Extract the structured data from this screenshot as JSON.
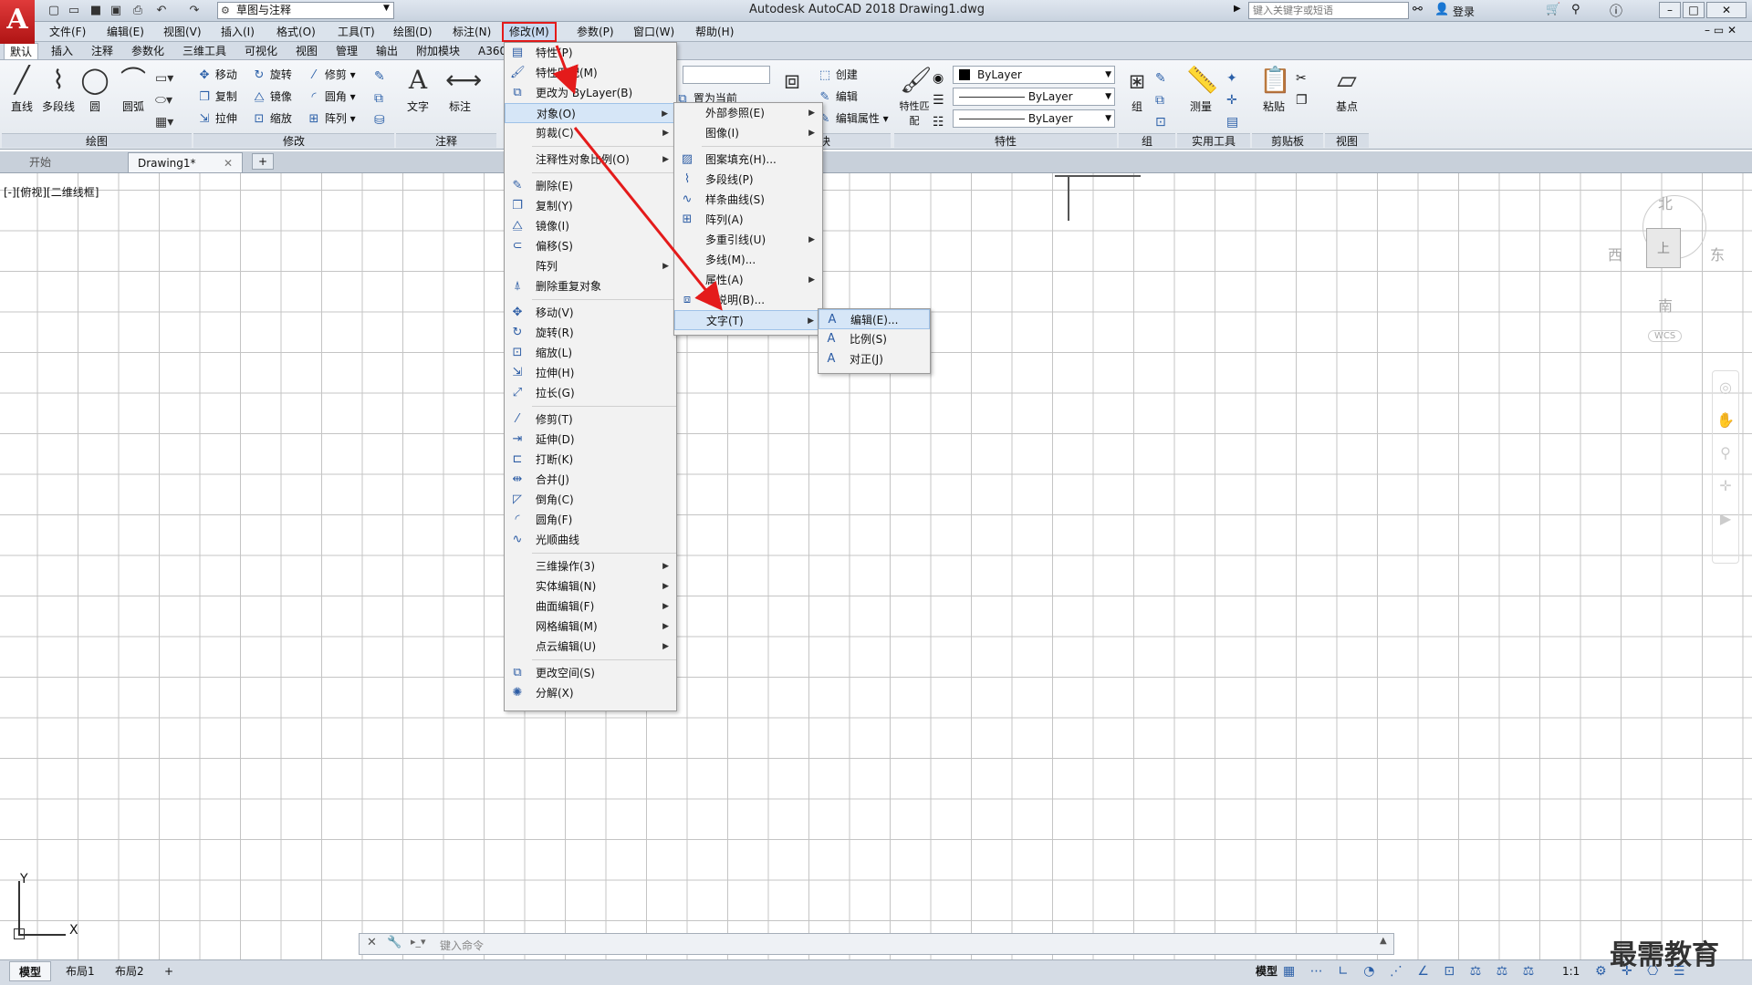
{
  "app": {
    "logo": "A",
    "title": "Autodesk AutoCAD 2018    Drawing1.dwg",
    "workspace": "草图与注释",
    "search_placeholder": "键入关键字或短语",
    "login": "登录"
  },
  "menubar": [
    "文件(F)",
    "编辑(E)",
    "视图(V)",
    "插入(I)",
    "格式(O)",
    "工具(T)",
    "绘图(D)",
    "标注(N)",
    "修改(M)",
    "参数(P)",
    "窗口(W)",
    "帮助(H)"
  ],
  "ribbon_tabs": [
    "默认",
    "插入",
    "注释",
    "参数化",
    "三维工具",
    "可视化",
    "视图",
    "管理",
    "输出",
    "附加模块",
    "A360"
  ],
  "ribbon": {
    "draw": {
      "line": "直线",
      "pline": "多段线",
      "circle": "圆",
      "arc": "圆弧",
      "panel": "绘图"
    },
    "modify": {
      "move": "移动",
      "rotate": "旋转",
      "trim": "修剪",
      "copy": "复制",
      "mirror": "镜像",
      "fillet": "圆角",
      "stretch": "拉伸",
      "scale": "缩放",
      "array": "阵列",
      "panel": "修改"
    },
    "annotation": {
      "text": "文字",
      "dim": "标注",
      "panel": "注释"
    },
    "layers": {
      "set_current": "置为当前"
    },
    "block": {
      "create": "创建",
      "edit": "编辑",
      "edit_attr": "编辑属性",
      "panel": "块"
    },
    "properties": {
      "match": "特性匹配",
      "color": "ByLayer",
      "linetype": "ByLayer",
      "lineweight": "ByLayer",
      "panel": "特性"
    },
    "groups": {
      "group": "组",
      "panel": "组"
    },
    "utilities": {
      "measure": "测量",
      "panel": "实用工具"
    },
    "clipboard": {
      "paste": "粘贴",
      "panel": "剪贴板"
    },
    "view": {
      "base": "基点",
      "panel": "视图"
    }
  },
  "doc_tabs": [
    "开始",
    "Drawing1*"
  ],
  "view_label": "[-][俯视][二维线框]",
  "viewcube": {
    "north": "北",
    "south": "南",
    "east": "东",
    "west": "西",
    "top": "上",
    "wcs": "WCS"
  },
  "modify_menu": [
    {
      "label": "特性(P)",
      "icon": "properties-icon"
    },
    {
      "label": "特性匹配(M)",
      "icon": "match-icon"
    },
    {
      "label": "更改为 ByLayer(B)",
      "icon": "bylayer-icon"
    },
    {
      "label": "对象(O)",
      "icon": "",
      "submenu": true
    },
    {
      "label": "剪裁(C)",
      "icon": "",
      "submenu": true
    },
    {
      "label": "注释性对象比例(O)",
      "icon": "",
      "submenu": true
    },
    {
      "label": "删除(E)",
      "icon": "erase-icon"
    },
    {
      "label": "复制(Y)",
      "icon": "copy-icon"
    },
    {
      "label": "镜像(I)",
      "icon": "mirror-icon"
    },
    {
      "label": "偏移(S)",
      "icon": "offset-icon"
    },
    {
      "label": "阵列",
      "icon": "",
      "submenu": true
    },
    {
      "label": "删除重复对象",
      "icon": "overkill-icon"
    },
    {
      "label": "移动(V)",
      "icon": "move-icon"
    },
    {
      "label": "旋转(R)",
      "icon": "rotate-icon"
    },
    {
      "label": "缩放(L)",
      "icon": "scale-icon"
    },
    {
      "label": "拉伸(H)",
      "icon": "stretch-icon"
    },
    {
      "label": "拉长(G)",
      "icon": "lengthen-icon"
    },
    {
      "label": "修剪(T)",
      "icon": "trim-icon"
    },
    {
      "label": "延伸(D)",
      "icon": "extend-icon"
    },
    {
      "label": "打断(K)",
      "icon": "break-icon"
    },
    {
      "label": "合并(J)",
      "icon": "join-icon"
    },
    {
      "label": "倒角(C)",
      "icon": "chamfer-icon"
    },
    {
      "label": "圆角(F)",
      "icon": "fillet-icon"
    },
    {
      "label": "光顺曲线",
      "icon": "blend-icon"
    },
    {
      "label": "三维操作(3)",
      "icon": "",
      "submenu": true
    },
    {
      "label": "实体编辑(N)",
      "icon": "",
      "submenu": true
    },
    {
      "label": "曲面编辑(F)",
      "icon": "",
      "submenu": true
    },
    {
      "label": "网格编辑(M)",
      "icon": "",
      "submenu": true
    },
    {
      "label": "点云编辑(U)",
      "icon": "",
      "submenu": true
    },
    {
      "label": "更改空间(S)",
      "icon": "chspace-icon"
    },
    {
      "label": "分解(X)",
      "icon": "explode-icon"
    }
  ],
  "object_menu": [
    {
      "label": "外部参照(E)",
      "submenu": true
    },
    {
      "label": "图像(I)",
      "submenu": true
    },
    {
      "label": "图案填充(H)...",
      "icon": "hatch-icon"
    },
    {
      "label": "多段线(P)",
      "icon": "pline-icon"
    },
    {
      "label": "样条曲线(S)",
      "icon": "spline-icon"
    },
    {
      "label": "阵列(A)",
      "icon": "array-icon"
    },
    {
      "label": "多重引线(U)",
      "submenu": true
    },
    {
      "label": "多线(M)...",
      "icon": ""
    },
    {
      "label": "属性(A)",
      "submenu": true
    },
    {
      "label": "块说明(B)...",
      "icon": "block-icon"
    },
    {
      "label": "文字(T)",
      "submenu": true
    }
  ],
  "text_menu": [
    {
      "label": "编辑(E)...",
      "icon": "text-edit-icon"
    },
    {
      "label": "比例(S)",
      "icon": "text-scale-icon"
    },
    {
      "label": "对正(J)",
      "icon": "text-justify-icon"
    }
  ],
  "command_placeholder": "键入命令",
  "layout_tabs": [
    "模型",
    "布局1",
    "布局2"
  ],
  "status": {
    "model": "模型",
    "scale": "1:1"
  },
  "watermark": "最需教育",
  "colors": {
    "highlight_box": "#e41b1b",
    "arrow": "#e41b1b"
  }
}
